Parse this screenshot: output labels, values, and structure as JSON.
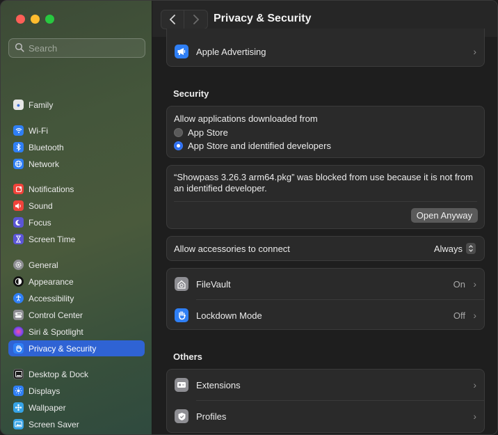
{
  "window": {
    "title": "Privacy & Security"
  },
  "search": {
    "placeholder": "Search"
  },
  "sidebar": {
    "items": [
      {
        "label": "Family",
        "icon": "family-icon",
        "color": "#e6e6e6"
      },
      {
        "label": "Wi-Fi",
        "icon": "wifi-icon",
        "color": "#2f7ff5"
      },
      {
        "label": "Bluetooth",
        "icon": "bluetooth-icon",
        "color": "#2f7ff5"
      },
      {
        "label": "Network",
        "icon": "network-icon",
        "color": "#2f7ff5"
      },
      {
        "label": "Notifications",
        "icon": "notifications-icon",
        "color": "#f0433a"
      },
      {
        "label": "Sound",
        "icon": "sound-icon",
        "color": "#f0433a"
      },
      {
        "label": "Focus",
        "icon": "focus-icon",
        "color": "#5b55d6"
      },
      {
        "label": "Screen Time",
        "icon": "screen-time-icon",
        "color": "#5b55d6"
      },
      {
        "label": "General",
        "icon": "general-icon",
        "color": "#8e8e93"
      },
      {
        "label": "Appearance",
        "icon": "appearance-icon",
        "color": "#1c1c1c"
      },
      {
        "label": "Accessibility",
        "icon": "accessibility-icon",
        "color": "#2f7ff5"
      },
      {
        "label": "Control Center",
        "icon": "control-center-icon",
        "color": "#8e8e93"
      },
      {
        "label": "Siri & Spotlight",
        "icon": "siri-icon",
        "color": "#b048c8"
      },
      {
        "label": "Privacy & Security",
        "icon": "hand-icon",
        "color": "#2f7ff5"
      },
      {
        "label": "Desktop & Dock",
        "icon": "dock-icon",
        "color": "#1c1c1c"
      },
      {
        "label": "Displays",
        "icon": "displays-icon",
        "color": "#2f7ff5"
      },
      {
        "label": "Wallpaper",
        "icon": "wallpaper-icon",
        "color": "#36a3e6"
      },
      {
        "label": "Screen Saver",
        "icon": "screen-saver-icon",
        "color": "#36a3e6"
      }
    ]
  },
  "main": {
    "apple_advertising": "Apple Advertising",
    "security_title": "Security",
    "allow_label": "Allow applications downloaded from",
    "option_app_store": "App Store",
    "option_identified": "App Store and identified developers",
    "blocked_message": "“Showpass 3.26.3 arm64.pkg” was blocked from use because it is not from an identified developer.",
    "open_anyway": "Open Anyway",
    "accessories_label": "Allow accessories to connect",
    "accessories_value": "Always",
    "filevault_label": "FileVault",
    "filevault_value": "On",
    "lockdown_label": "Lockdown Mode",
    "lockdown_value": "Off",
    "others_title": "Others",
    "extensions_label": "Extensions",
    "profiles_label": "Profiles"
  },
  "colors": {
    "accent": "#2f63d4",
    "selected_sidebar": "#2f63d4"
  }
}
